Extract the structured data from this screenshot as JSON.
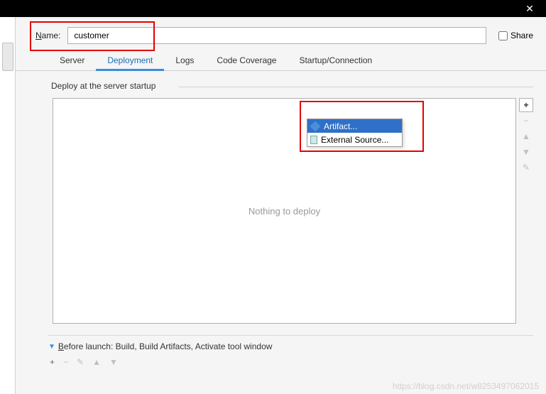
{
  "name_label_pre": "N",
  "name_label_post": "ame:",
  "name_value": "customer",
  "share_label_pre": "S",
  "share_label_post": "hare",
  "tabs": {
    "server": "Server",
    "deployment": "Deployment",
    "logs": "Logs",
    "code_coverage": "Code Coverage",
    "startup": "Startup/Connection"
  },
  "section_label": "Deploy at the server startup",
  "nothing_text": "Nothing to deploy",
  "menu": {
    "artifact": "Artifact...",
    "external": "External Source..."
  },
  "before_launch_pre": "B",
  "before_launch_post": "efore launch: Build, Build Artifacts, Activate tool window",
  "watermark": "https://blog.csdn.net/w8253497062015"
}
